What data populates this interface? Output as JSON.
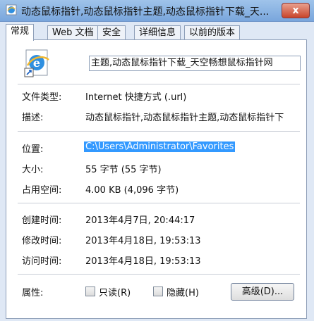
{
  "window": {
    "title": "动态鼠标指针,动态鼠标指针主题,动态鼠标指针下载_天...",
    "close_label": "x"
  },
  "tabs": [
    {
      "label": "常规",
      "active": true
    },
    {
      "label": "Web 文档",
      "active": false
    },
    {
      "label": "安全",
      "active": false
    },
    {
      "label": "详细信息",
      "active": false
    },
    {
      "label": "以前的版本",
      "active": false
    }
  ],
  "file": {
    "icon": "internet-shortcut-icon",
    "name": "主题,动态鼠标指针下载_天空畅想鼠标指针网"
  },
  "properties": {
    "type_label": "文件类型:",
    "type_value": "Internet 快捷方式 (.url)",
    "desc_label": "描述:",
    "desc_value": "动态鼠标指针,动态鼠标指针主题,动态鼠标指针下",
    "location_label": "位置:",
    "location_value": "C:\\Users\\Administrator\\Favorites",
    "size_label": "大小:",
    "size_value": "55 字节 (55 字节)",
    "disk_label": "占用空间:",
    "disk_value": "4.00 KB (4,096 字节)",
    "created_label": "创建时间:",
    "created_value": "2013年4月7日, 20:44:17",
    "modified_label": "修改时间:",
    "modified_value": "2013年4月18日, 19:53:13",
    "accessed_label": "访问时间:",
    "accessed_value": "2013年4月18日, 19:53:13",
    "attr_label": "属性:",
    "readonly_label": "只读(R)",
    "hidden_label": "隐藏(H)",
    "advanced_label": "高级(D)..."
  },
  "colors": {
    "selection": "#3399ff",
    "titlebar": "#79a6dc"
  }
}
